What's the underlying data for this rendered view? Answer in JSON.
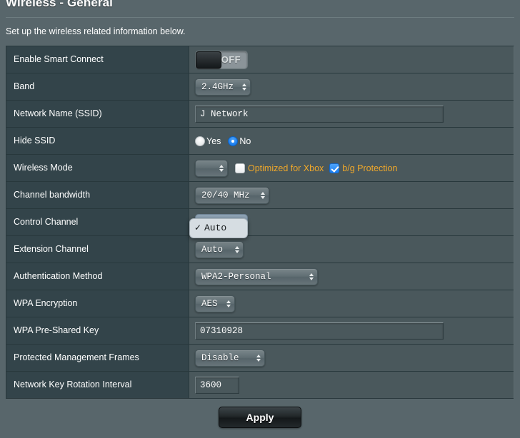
{
  "header": {
    "title": "Wireless - General",
    "description": "Set up the wireless related information below."
  },
  "rows": {
    "smart_connect": {
      "label": "Enable Smart Connect",
      "toggle_state": "OFF"
    },
    "band": {
      "label": "Band",
      "value": "2.4GHz"
    },
    "ssid": {
      "label": "Network Name (SSID)",
      "value": "J Network",
      "placeholder": ""
    },
    "hide_ssid": {
      "label": "Hide SSID",
      "options": [
        {
          "label": "Yes",
          "checked": false
        },
        {
          "label": "No",
          "checked": true
        }
      ]
    },
    "wireless_mode": {
      "label": "Wireless Mode",
      "value": "",
      "checkboxes": [
        {
          "label": "Optimized for Xbox",
          "checked": false
        },
        {
          "label": "b/g Protection",
          "checked": true
        }
      ]
    },
    "channel_bandwidth": {
      "label": "Channel bandwidth",
      "value": "20/40 MHz"
    },
    "control_channel": {
      "label": "Control Channel",
      "value": "Auto",
      "open": true,
      "menu_items": [
        {
          "label": "Auto",
          "checked": true
        }
      ],
      "check_glyph": "✓"
    },
    "extension_channel": {
      "label": "Extension Channel",
      "value": "Auto"
    },
    "auth_method": {
      "label": "Authentication Method",
      "value": "WPA2-Personal"
    },
    "wpa_encryption": {
      "label": "WPA Encryption",
      "value": "AES"
    },
    "psk": {
      "label": "WPA Pre-Shared Key",
      "value": "07310928",
      "placeholder": ""
    },
    "pmf": {
      "label": "Protected Management Frames",
      "value": "Disable"
    },
    "key_rotation": {
      "label": "Network Key Rotation Interval",
      "value": "3600",
      "placeholder": ""
    }
  },
  "footer": {
    "apply_label": "Apply"
  },
  "colors": {
    "page_background": "#58666b",
    "label_column": "#33444a",
    "value_column": "#4a585c",
    "accent_orange": "#f0a82a",
    "accent_blue": "#1a7ef0",
    "border_dark": "#28383c"
  }
}
